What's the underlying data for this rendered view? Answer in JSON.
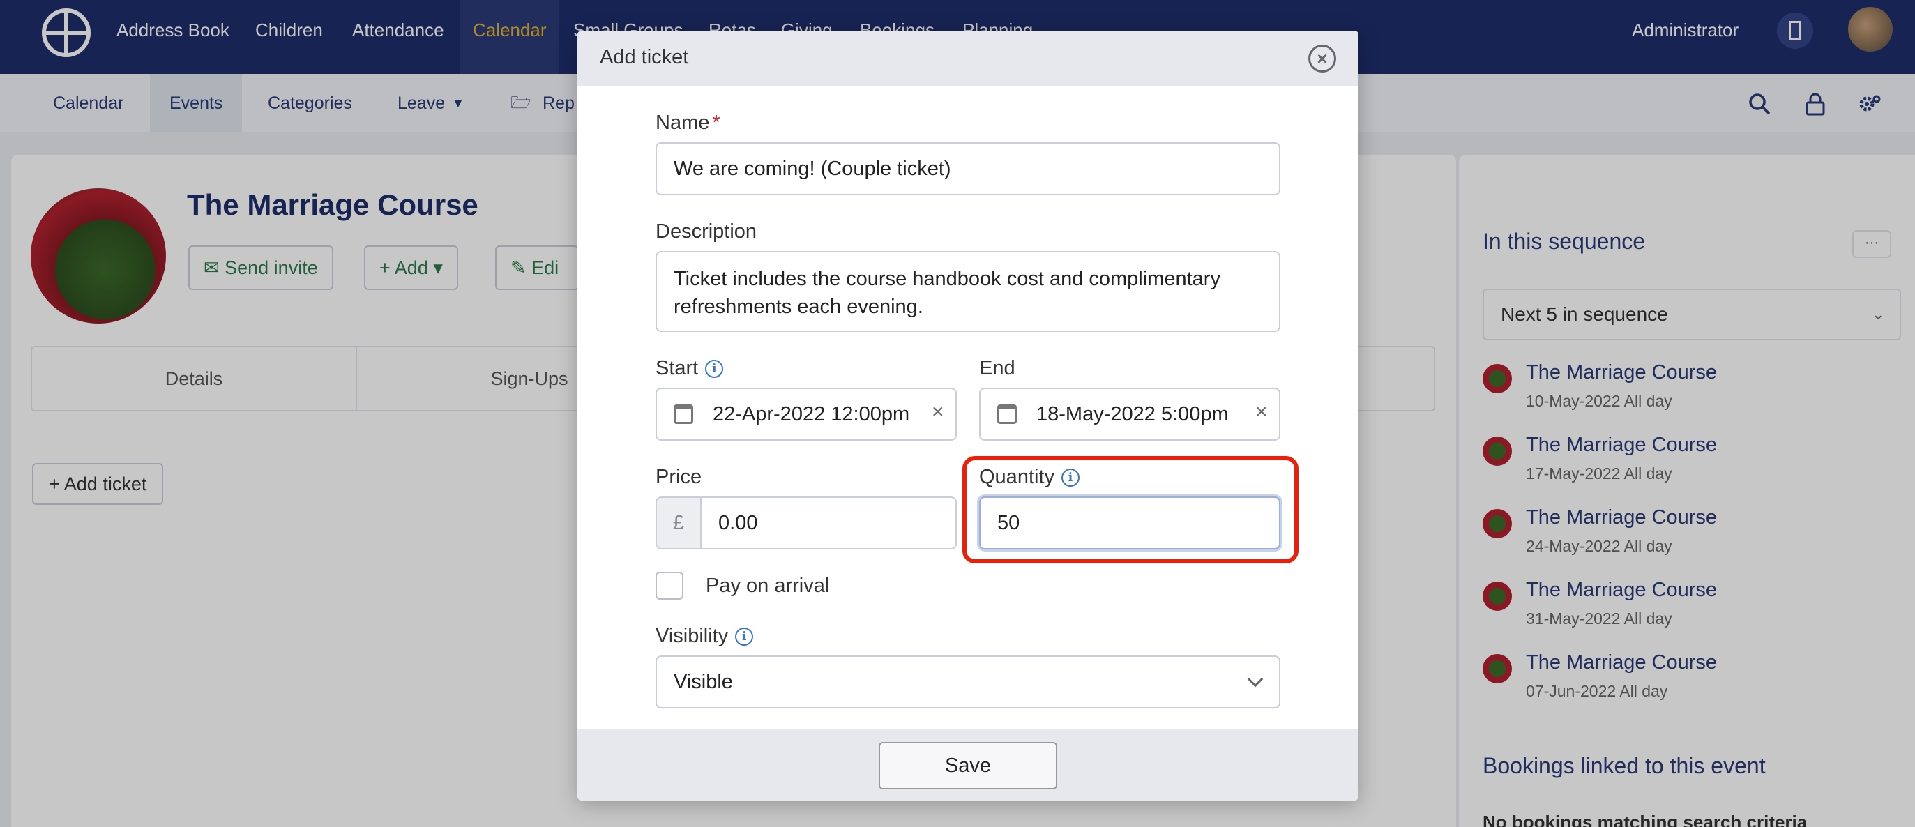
{
  "nav": {
    "items": [
      "Address Book",
      "Children",
      "Attendance",
      "Calendar",
      "Small Groups",
      "Rotas",
      "Giving",
      "Bookings",
      "Planning"
    ],
    "active": "Calendar",
    "user_label": "Administrator"
  },
  "subnav": {
    "items": [
      "Calendar",
      "Events",
      "Categories",
      "Leave",
      "Rep"
    ],
    "active": "Events"
  },
  "event": {
    "title": "The Marriage Course",
    "buttons": [
      "Send invite",
      "Add",
      "Edi"
    ],
    "tabs": [
      "Details",
      "Sign-Ups"
    ],
    "add_ticket_label": "Add ticket"
  },
  "sidebar": {
    "sequence_heading": "In this sequence",
    "more_label": "···",
    "sequence_select": "Next 5 in sequence",
    "sequence_items": [
      {
        "title": "The Marriage Course",
        "date": "10-May-2022 All day"
      },
      {
        "title": "The Marriage Course",
        "date": "17-May-2022 All day"
      },
      {
        "title": "The Marriage Course",
        "date": "24-May-2022 All day"
      },
      {
        "title": "The Marriage Course",
        "date": "31-May-2022 All day"
      },
      {
        "title": "The Marriage Course",
        "date": "07-Jun-2022 All day"
      }
    ],
    "bookings_heading": "Bookings linked to this event",
    "bookings_empty": "No bookings matching search criteria"
  },
  "modal": {
    "title": "Add ticket",
    "name_label": "Name",
    "name_value": "We are coming! (Couple ticket)",
    "description_label": "Description",
    "description_value": "Ticket includes the course handbook cost and complimentary refreshments each evening.",
    "start_label": "Start",
    "start_value": "22-Apr-2022 12:00pm",
    "end_label": "End",
    "end_value": "18-May-2022 5:00pm",
    "price_label": "Price",
    "currency_symbol": "£",
    "price_value": "0.00",
    "quantity_label": "Quantity",
    "quantity_value": "50",
    "pay_on_arrival_label": "Pay on arrival",
    "visibility_label": "Visibility",
    "visibility_value": "Visible",
    "save_label": "Save"
  },
  "colors": {
    "nav_bg": "#1e2e6b",
    "highlight": "#e8200c",
    "info": "#3a78c2",
    "required": "#d0242a"
  }
}
